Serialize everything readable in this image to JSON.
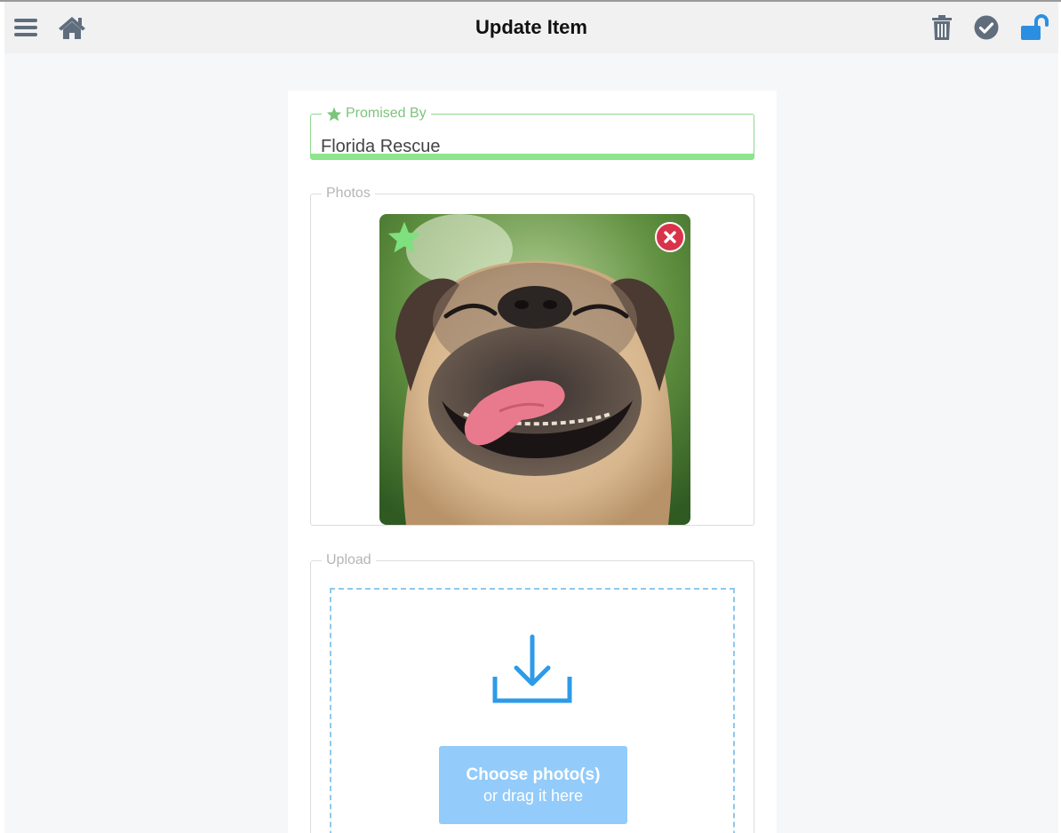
{
  "toolbar": {
    "title": "Update Item",
    "left_icons": [
      "menu-icon",
      "home-icon"
    ],
    "right_icons": [
      "trash-icon",
      "check-circle-icon",
      "unlock-icon"
    ],
    "accent_color": "#2a8fe0"
  },
  "promised_by": {
    "legend": "Promised By",
    "value": "Florida Rescue",
    "accent_color": "#7cc47c"
  },
  "photos": {
    "legend": "Photos",
    "items": [
      {
        "subject": "pug-photo",
        "is_primary": true
      }
    ]
  },
  "upload": {
    "legend": "Upload",
    "button_line1": "Choose photo(s)",
    "button_line2": "or drag it here"
  }
}
